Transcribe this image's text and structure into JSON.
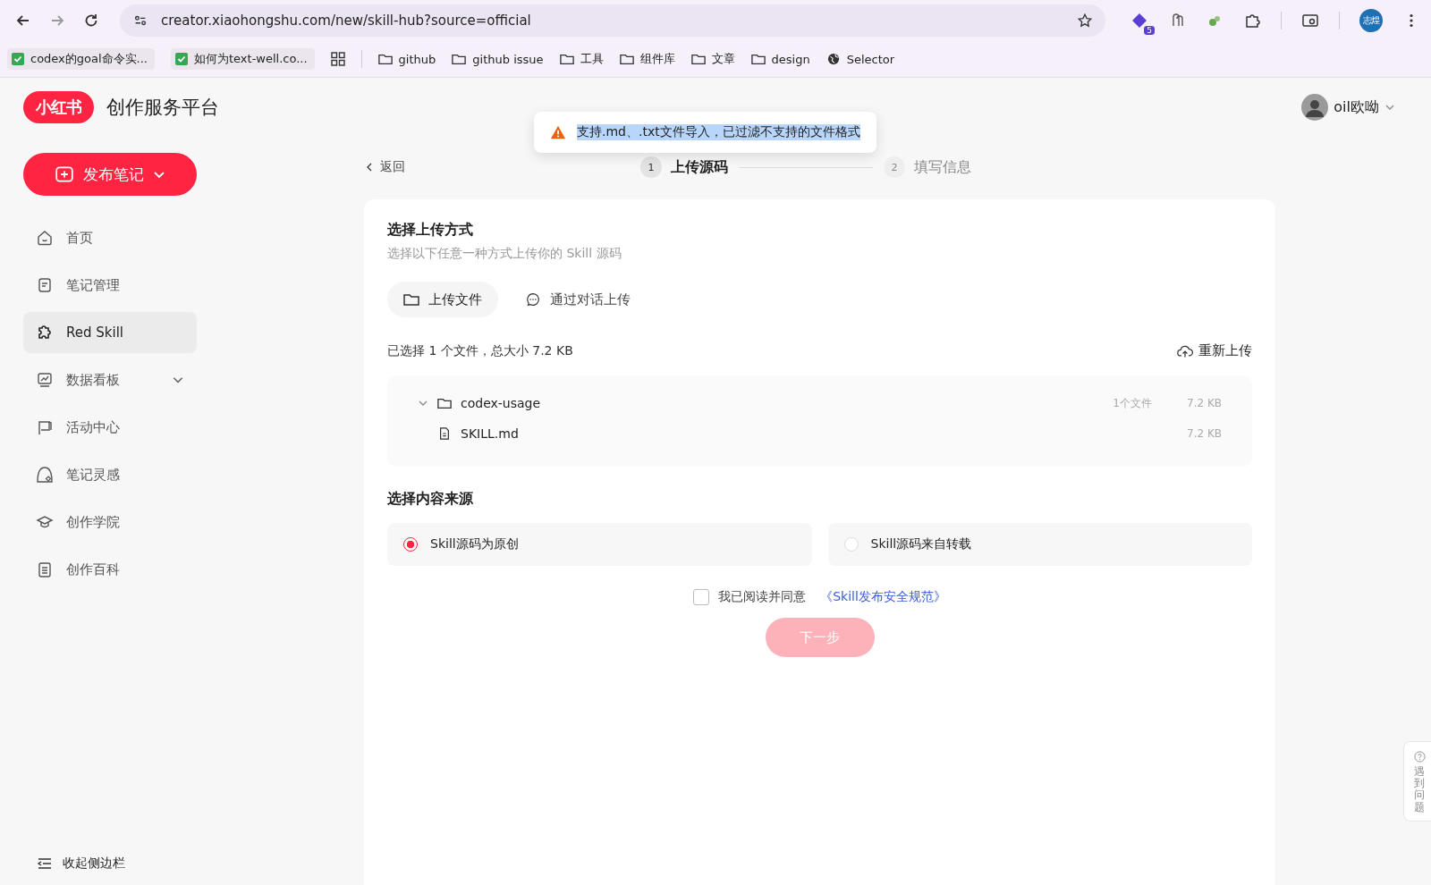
{
  "browser": {
    "url": "creator.xiaohongshu.com/new/skill-hub?source=official",
    "extension_badge": "5",
    "profile": "志煌",
    "bookmarks": [
      {
        "kind": "page",
        "label": "codex的goal命令实..."
      },
      {
        "kind": "page",
        "label": "如何为text-well.co..."
      },
      {
        "kind": "apps"
      },
      {
        "kind": "folder",
        "label": "github"
      },
      {
        "kind": "folder",
        "label": "github issue"
      },
      {
        "kind": "folder",
        "label": "工具"
      },
      {
        "kind": "folder",
        "label": "组件库"
      },
      {
        "kind": "folder",
        "label": "文章"
      },
      {
        "kind": "folder",
        "label": "design"
      },
      {
        "kind": "site",
        "label": "Selector"
      }
    ]
  },
  "header": {
    "logo": "小红书",
    "title": "创作服务平台",
    "user": "oil欧呦"
  },
  "sidebar": {
    "publish_button": "发布笔记",
    "items": [
      {
        "label": "首页",
        "selected": false,
        "expandable": false
      },
      {
        "label": "笔记管理",
        "selected": false,
        "expandable": false
      },
      {
        "label": "Red Skill",
        "selected": true,
        "expandable": false
      },
      {
        "label": "数据看板",
        "selected": false,
        "expandable": true
      },
      {
        "label": "活动中心",
        "selected": false,
        "expandable": false
      },
      {
        "label": "笔记灵感",
        "selected": false,
        "expandable": false
      },
      {
        "label": "创作学院",
        "selected": false,
        "expandable": false
      },
      {
        "label": "创作百科",
        "selected": false,
        "expandable": false
      }
    ],
    "collapse": "收起侧边栏"
  },
  "toast": {
    "text": "支持.md、.txt文件导入，已过滤不支持的文件格式"
  },
  "back": "返回",
  "steps": [
    {
      "number": "1",
      "label": "上传源码",
      "selected": true
    },
    {
      "number": "2",
      "label": "填写信息",
      "selected": false
    }
  ],
  "upload": {
    "title": "选择上传方式",
    "subtitle": "选择以下任意一种方式上传你的 Skill 源码",
    "methods": [
      {
        "label": "上传文件",
        "selected": true
      },
      {
        "label": "通过对话上传",
        "selected": false
      }
    ],
    "summary": "已选择 1 个文件，总大小 7.2 KB",
    "reupload": "重新上传",
    "tree": [
      {
        "name": "codex-usage",
        "count": "1个文件",
        "size": "7.2 KB",
        "expanded": true,
        "children": [
          {
            "name": "SKILL.md",
            "size": "7.2 KB"
          }
        ]
      }
    ]
  },
  "source": {
    "title": "选择内容来源",
    "options": [
      {
        "label": "Skill源码为原创",
        "selected": true
      },
      {
        "label": "Skill源码来自转载",
        "selected": false
      }
    ]
  },
  "agreement": {
    "checked": false,
    "text": "我已阅读并同意",
    "link": "《Skill发布安全规范》"
  },
  "next_button": {
    "label": "下一步",
    "disabled": true
  },
  "help": {
    "label": "遇到问题"
  }
}
